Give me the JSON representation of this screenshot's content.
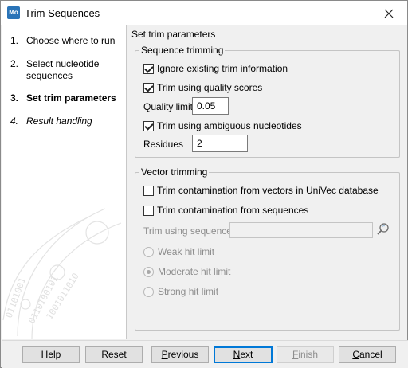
{
  "window": {
    "title": "Trim Sequences",
    "app_icon_text": "Mo"
  },
  "steps": [
    {
      "num": "1.",
      "label": "Choose where to run",
      "state": "done"
    },
    {
      "num": "2.",
      "label": "Select nucleotide sequences",
      "state": "done"
    },
    {
      "num": "3.",
      "label": "Set trim parameters",
      "state": "current"
    },
    {
      "num": "4.",
      "label": "Result handling",
      "state": "future"
    }
  ],
  "page": {
    "heading": "Set trim parameters"
  },
  "sequence_trimming": {
    "title": "Sequence trimming",
    "ignore_existing": {
      "label": "Ignore existing trim information",
      "checked": true
    },
    "quality_scores": {
      "label": "Trim using quality scores",
      "checked": true
    },
    "quality_limit": {
      "label": "Quality limit",
      "value": "0.05"
    },
    "ambiguous": {
      "label": "Trim using ambiguous nucleotides",
      "checked": true
    },
    "residues": {
      "label": "Residues",
      "value": "2"
    }
  },
  "vector_trimming": {
    "title": "Vector trimming",
    "univec": {
      "label": "Trim contamination from vectors in UniVec database",
      "checked": false
    },
    "from_sequences": {
      "label": "Trim contamination from sequences",
      "checked": false
    },
    "trim_using_sequences": {
      "label": "Trim using sequences",
      "value": ""
    },
    "hit_limits": [
      {
        "label": "Weak hit limit",
        "selected": false
      },
      {
        "label": "Moderate hit limit",
        "selected": true
      },
      {
        "label": "Strong hit limit",
        "selected": false
      }
    ]
  },
  "footer": {
    "help": "Help",
    "reset": "Reset",
    "previous": {
      "before": "",
      "mnemonic": "P",
      "after": "revious"
    },
    "next": {
      "before": "",
      "mnemonic": "N",
      "after": "ext"
    },
    "finish": {
      "before": "",
      "mnemonic": "F",
      "after": "inish"
    },
    "cancel": {
      "before": "",
      "mnemonic": "C",
      "after": "ancel"
    }
  }
}
